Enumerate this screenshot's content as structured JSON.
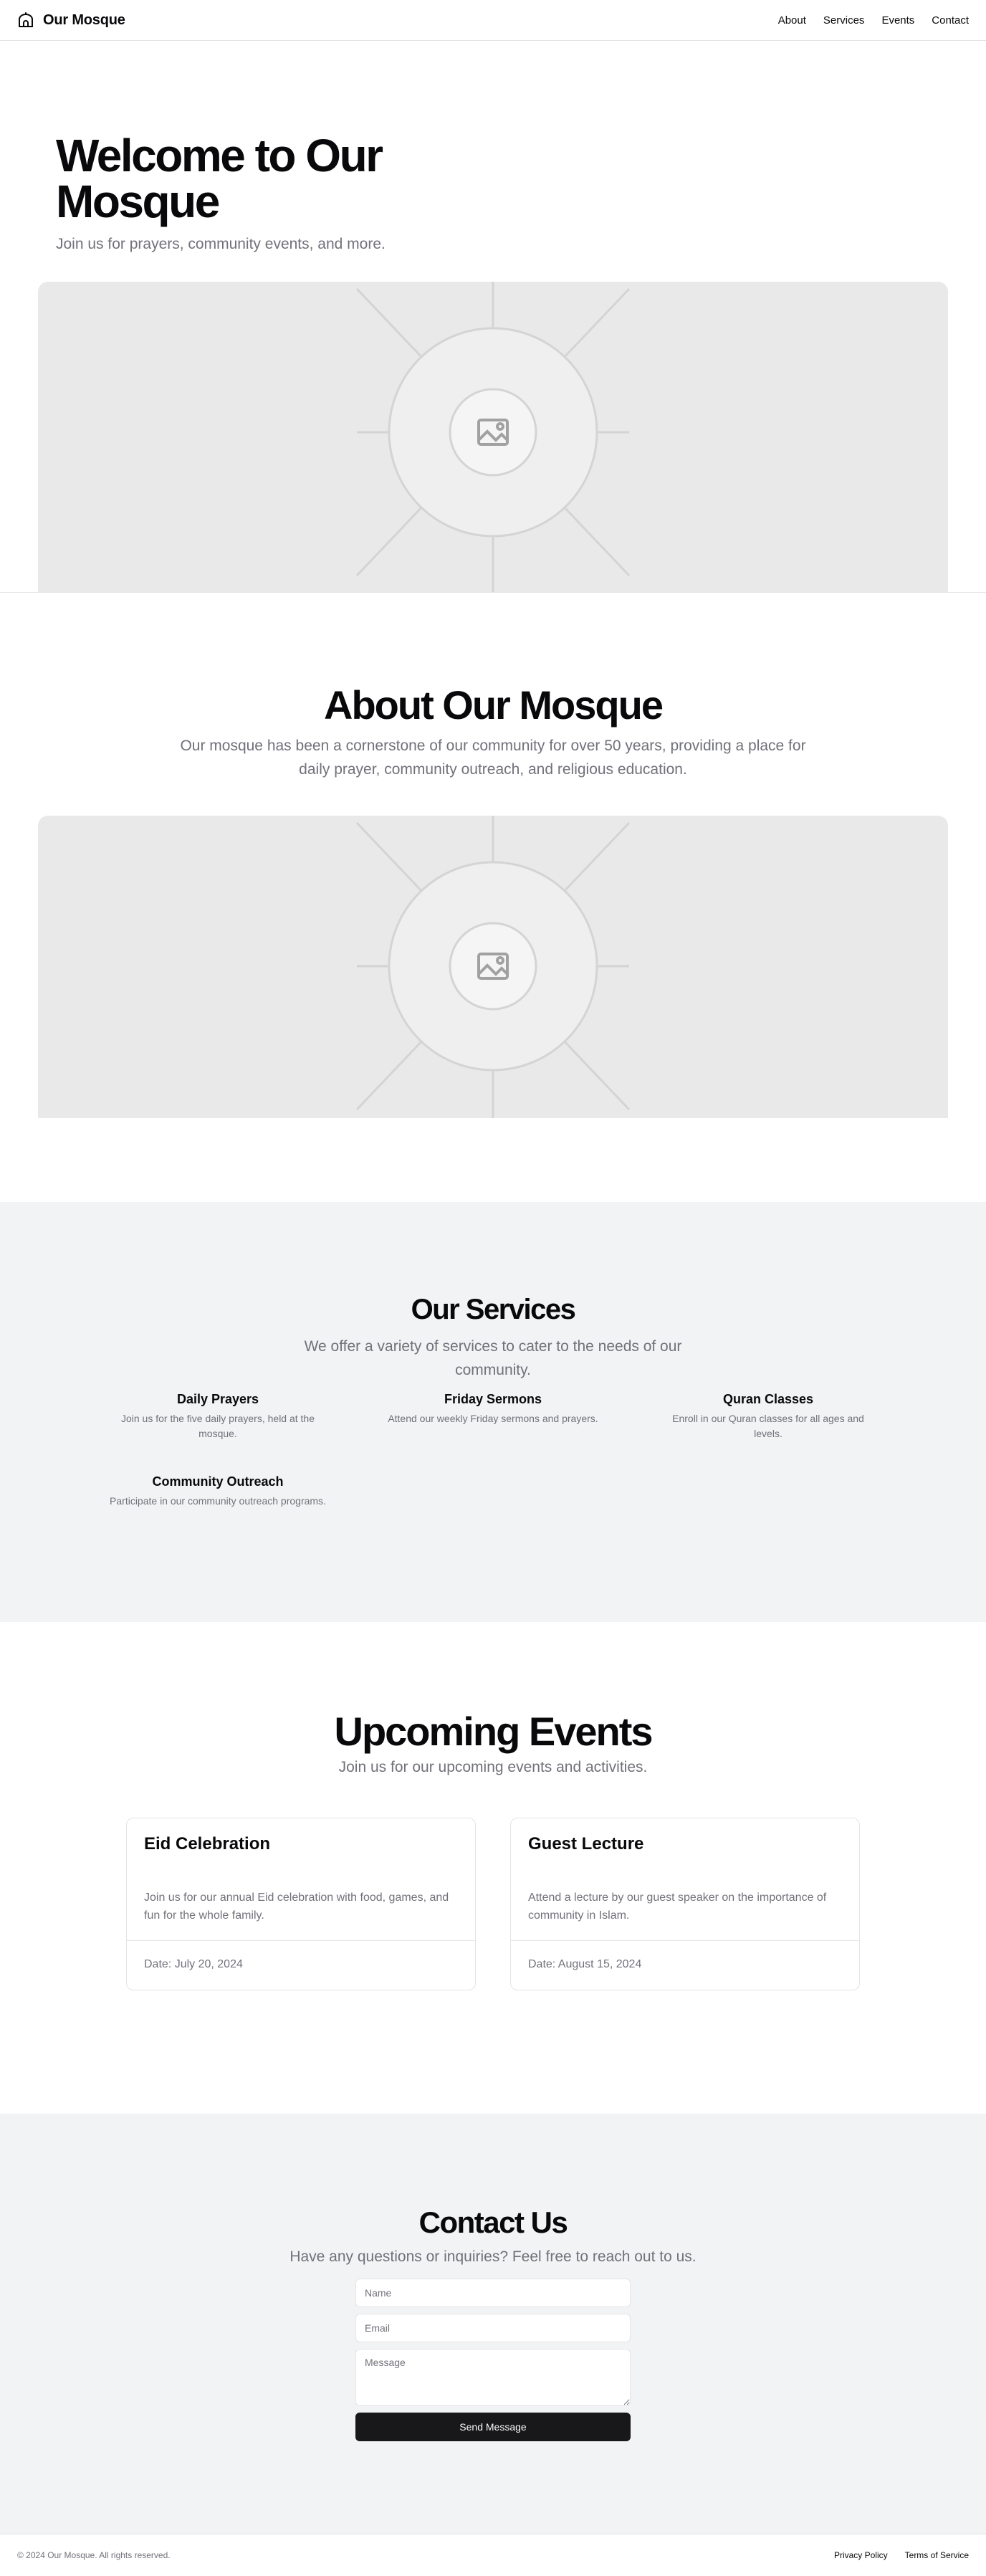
{
  "header": {
    "brand_icon": "mosque-icon",
    "brand_name": "Our Mosque",
    "nav": [
      "About",
      "Services",
      "Events",
      "Contact"
    ]
  },
  "hero": {
    "title": "Welcome to Our Mosque",
    "subtitle": "Join us for prayers, community events, and more.",
    "image_icon": "image-placeholder-icon"
  },
  "about": {
    "title": "About Our Mosque",
    "text": "Our mosque has been a cornerstone of our community for over 50 years, providing a place for daily prayer, community outreach, and religious education.",
    "image_icon": "image-placeholder-icon"
  },
  "services": {
    "title": "Our Services",
    "subtitle": "We offer a variety of services to cater to the needs of our community.",
    "items": [
      {
        "name": "Daily Prayers",
        "desc": "Join us for the five daily prayers, held at the mosque."
      },
      {
        "name": "Friday Sermons",
        "desc": "Attend our weekly Friday sermons and prayers."
      },
      {
        "name": "Quran Classes",
        "desc": "Enroll in our Quran classes for all ages and levels."
      },
      {
        "name": "Community Outreach",
        "desc": "Participate in our community outreach programs."
      }
    ]
  },
  "events": {
    "title": "Upcoming Events",
    "subtitle": "Join us for our upcoming events and activities.",
    "items": [
      {
        "title": "Eid Celebration",
        "desc": "Join us for our annual Eid celebration with food, games, and fun for the whole family.",
        "date": "Date: July 20, 2024"
      },
      {
        "title": "Guest Lecture",
        "desc": "Attend a lecture by our guest speaker on the importance of community in Islam.",
        "date": "Date: August 15, 2024"
      }
    ]
  },
  "contact": {
    "title": "Contact Us",
    "subtitle": "Have any questions or inquiries? Feel free to reach out to us.",
    "name_placeholder": "Name",
    "email_placeholder": "Email",
    "message_placeholder": "Message",
    "submit_label": "Send Message"
  },
  "footer": {
    "copyright": "© 2024 Our Mosque. All rights reserved.",
    "links": [
      "Privacy Policy",
      "Terms of Service"
    ]
  },
  "colors": {
    "primary_text": "#09090b",
    "muted_text": "#71717a",
    "section_bg": "#f2f3f5",
    "border": "#e4e4e7",
    "button_bg": "#18181b",
    "placeholder_bg": "#e9e9e9"
  }
}
